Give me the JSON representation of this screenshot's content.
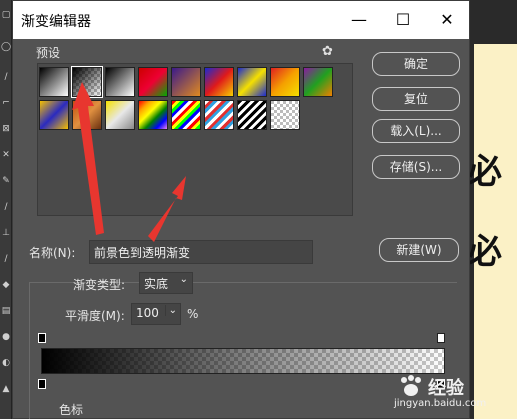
{
  "window": {
    "title": "渐变编辑器",
    "minimize_glyph": "—",
    "maximize_glyph": "☐",
    "close_glyph": "✕"
  },
  "presets": {
    "label": "预设",
    "gear_glyph": "✿"
  },
  "buttons": {
    "ok": "确定",
    "reset": "复位",
    "load": "载入(L)...",
    "save": "存储(S)...",
    "new": "新建(W)"
  },
  "name": {
    "label": "名称(N):",
    "value": "前景色到透明渐变"
  },
  "gradient": {
    "type_label": "渐变类型:",
    "type_value": "实底",
    "smoothness_label": "平滑度(M):",
    "smoothness_value": "100",
    "smoothness_unit": "%"
  },
  "color_section": {
    "label": "色标"
  },
  "background_doc": {
    "char1": "必",
    "char2": "必"
  },
  "watermark": {
    "brand": "经验",
    "url": "jingyan.baidu.com"
  },
  "colors": {
    "annotation": "#e8362f",
    "dialog_bg": "#535353"
  }
}
